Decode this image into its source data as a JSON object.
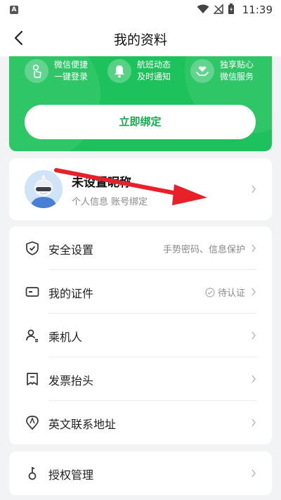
{
  "status_bar": {
    "time": "11:39",
    "app_badge": "A"
  },
  "nav": {
    "title": "我的资料"
  },
  "promo": {
    "perks": [
      {
        "line1": "微信便捷",
        "line2": "一键登录",
        "icon": "hand-tap-icon"
      },
      {
        "line1": "航班动态",
        "line2": "及时通知",
        "icon": "bell-icon"
      },
      {
        "line1": "独享贴心",
        "line2": "微信服务",
        "icon": "heart-hand-icon"
      }
    ],
    "bind_button": "立即绑定"
  },
  "profile": {
    "nickname": "未设置昵称",
    "subtitle": "个人信息 账号绑定"
  },
  "menu": [
    {
      "label": "安全设置",
      "value": "手势密码、信息保护",
      "icon": "shield-icon"
    },
    {
      "label": "我的证件",
      "value": "待认证",
      "icon": "id-card-icon",
      "status_icon": "check-circle-icon"
    },
    {
      "label": "乘机人",
      "value": "",
      "icon": "passenger-icon"
    },
    {
      "label": "发票抬头",
      "value": "",
      "icon": "invoice-icon"
    },
    {
      "label": "英文联系地址",
      "value": "",
      "icon": "location-icon"
    }
  ],
  "auth": {
    "label": "授权管理",
    "icon": "key-icon"
  },
  "colors": {
    "brand_green": "#1ec25c",
    "annotation_arrow": "#e8202a"
  }
}
